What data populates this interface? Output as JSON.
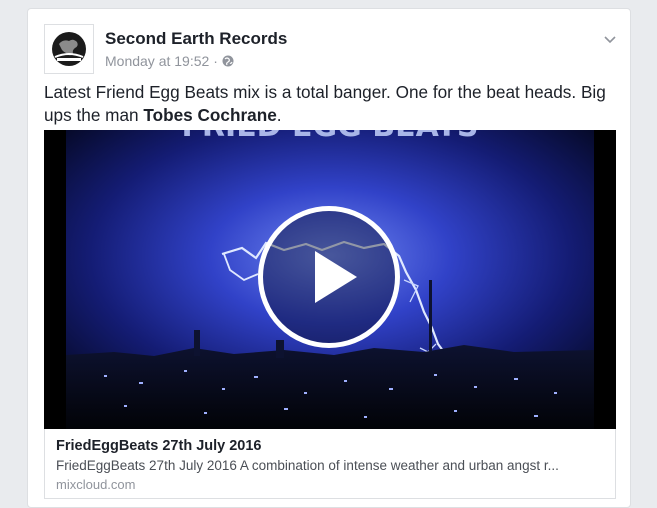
{
  "post": {
    "page_name": "Second Earth Records",
    "timestamp": "Monday at 19:52",
    "separator": "·",
    "privacy_icon": "globe-icon",
    "options_icon": "chevron-down-icon",
    "text_before": "Latest Friend Egg Beats mix is a total banger. One for the beat heads. Big ups the man ",
    "text_mention": "Tobes Cochrane",
    "text_after": "."
  },
  "media": {
    "overlay_text": "FRIED EGG BEATS",
    "play_icon": "play-icon"
  },
  "link_preview": {
    "title": "FriedEggBeats 27th July 2016",
    "description": "FriedEggBeats 27th July 2016 A combination of intense weather and urban angst r...",
    "domain": "mixcloud.com"
  },
  "colors": {
    "background": "#e9ebee",
    "card": "#ffffff",
    "text": "#1d2129",
    "muted": "#90949c",
    "border": "#dddfe2"
  }
}
